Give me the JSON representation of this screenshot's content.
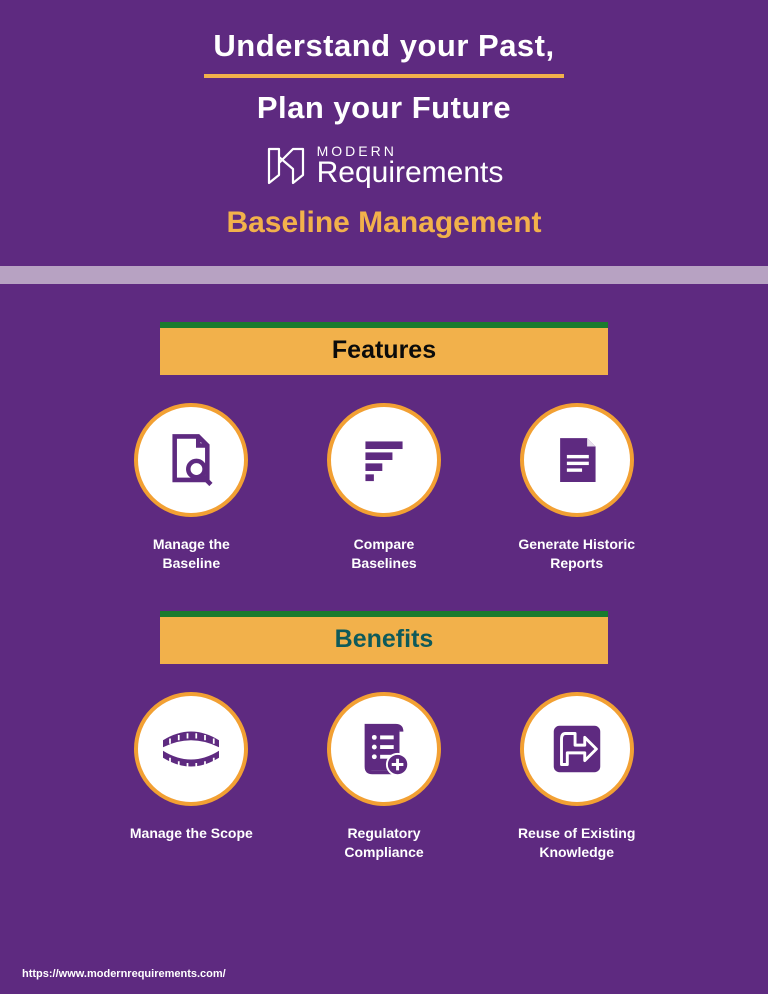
{
  "header": {
    "title_line1": "Understand your Past,",
    "title_line2": "Plan your Future",
    "logo_modern": "MODERN",
    "logo_requirements": "Requirements",
    "subtitle": "Baseline Management"
  },
  "sections": {
    "features": {
      "label": "Features",
      "items": [
        {
          "label": "Manage the\nBaseline"
        },
        {
          "label": "Compare\nBaselines"
        },
        {
          "label": "Generate Historic\nReports"
        }
      ]
    },
    "benefits": {
      "label": "Benefits",
      "items": [
        {
          "label": "Manage the Scope"
        },
        {
          "label": "Regulatory\nCompliance"
        },
        {
          "label": "Reuse of Existing\nKnowledge"
        }
      ]
    }
  },
  "footer": {
    "url": "https://www.modernrequirements.com/"
  }
}
